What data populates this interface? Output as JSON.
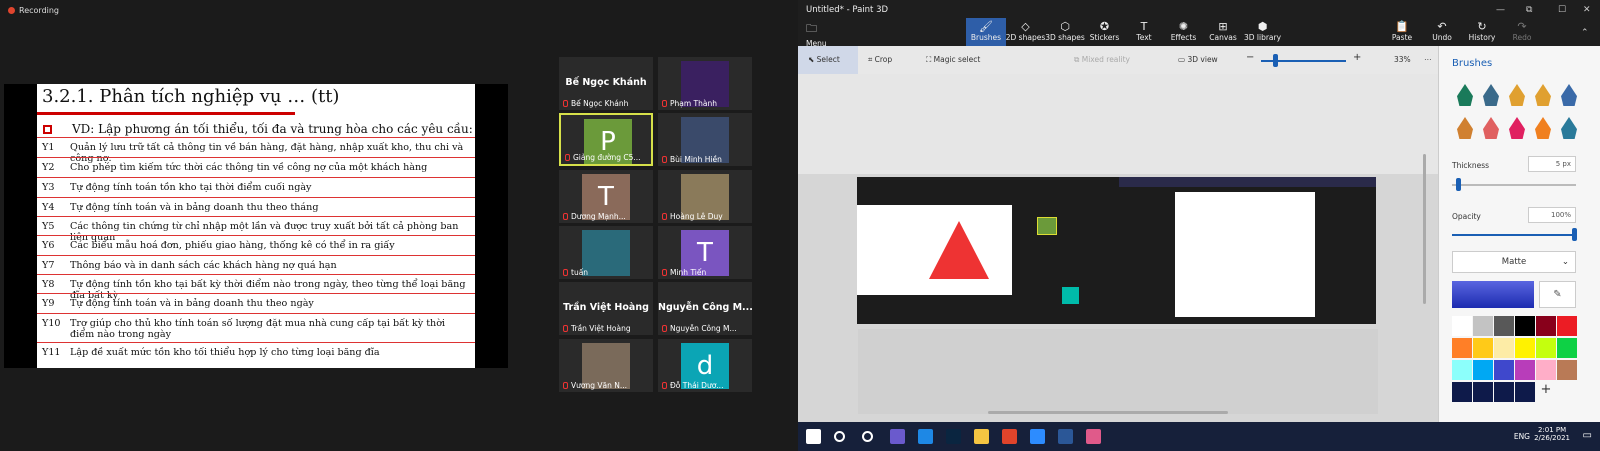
{
  "meeting": {
    "recording_label": "Recording",
    "slide": {
      "title": "3.2.1. Phân tích nghiệp vụ … (tt)",
      "vd": "VD: Lập phương án tối thiểu, tối đa và trung hòa cho các yêu cầu:",
      "rows": [
        {
          "id": "Y1",
          "text": "Quản lý lưu trữ tất cả thông tin về bán hàng, đặt hàng, nhập xuất kho, thu chi và công nợ."
        },
        {
          "id": "Y2",
          "text": "Cho phép tìm kiếm tức thời các thông tin về công nợ của một khách hàng"
        },
        {
          "id": "Y3",
          "text": "Tự động tính toán tồn kho tại thời điểm cuối ngày"
        },
        {
          "id": "Y4",
          "text": "Tự động tính toán và in bảng doanh thu theo tháng"
        },
        {
          "id": "Y5",
          "text": "Các thông tin chứng từ chỉ nhập một lần và được truy xuất bởi tất cả phòng ban liên quan"
        },
        {
          "id": "Y6",
          "text": "Các biểu mẫu hoá đơn, phiếu giao hàng, thống kê có thể in ra giấy"
        },
        {
          "id": "Y7",
          "text": "Thông báo và in danh sách các khách hàng nợ quá hạn"
        },
        {
          "id": "Y8",
          "text": "Tự động tính tồn kho tại bất kỳ thời điểm nào trong ngày, theo từng thể loại băng đĩa bất kỳ"
        },
        {
          "id": "Y9",
          "text": "Tự động tính toán và in bảng doanh thu theo ngày"
        },
        {
          "id": "Y10",
          "text": "Trợ giúp cho thủ kho tính toán số lượng đặt mua nhà cung cấp tại bất kỳ thời điểm nào trong ngày"
        },
        {
          "id": "Y11",
          "text": "Lập đề xuất mức tồn kho tối thiểu hợp lý cho từng loại băng đĩa"
        }
      ]
    },
    "participants": [
      {
        "name": "Bế Ngọc Khánh",
        "avatar": "",
        "name_only": true
      },
      {
        "name": "Phạm Thành",
        "avatar": "",
        "name_only": false
      },
      {
        "name": "Giảng đường C5...",
        "avatar": "P",
        "name_only": false
      },
      {
        "name": "Bùi Minh Hiền",
        "avatar": "",
        "name_only": false
      },
      {
        "name": "Dương Mạnh...",
        "avatar": "T",
        "name_only": false
      },
      {
        "name": "Hoàng Lê Duy",
        "avatar": "",
        "name_only": false
      },
      {
        "name": "tuấn",
        "avatar": "",
        "name_only": false
      },
      {
        "name": "Minh Tiến",
        "avatar": "T",
        "name_only": false
      },
      {
        "name": "Trần Việt Hoàng",
        "avatar": "",
        "name_only": true
      },
      {
        "name": "Nguyễn Công M...",
        "avatar": "",
        "name_only": true
      },
      {
        "name": "Vương Văn N...",
        "avatar": "",
        "name_only": false
      },
      {
        "name": "Đỗ Thái Dươ...",
        "avatar": "d",
        "name_only": false
      }
    ]
  },
  "paint": {
    "window_title": "Untitled* - Paint 3D",
    "menu_label": "Menu",
    "tools": [
      "Brushes",
      "2D shapes",
      "3D shapes",
      "Stickers",
      "Text",
      "Effects",
      "Canvas",
      "3D library"
    ],
    "right_tools": [
      "Paste",
      "Undo",
      "History",
      "Redo"
    ],
    "subbar": {
      "select": "Select",
      "crop": "Crop",
      "magic": "Magic select",
      "mixed": "Mixed reality",
      "view3d": "3D view",
      "zoom": "33%"
    },
    "sidebar": {
      "title": "Brushes",
      "thickness_label": "Thickness",
      "thickness_value": "5 px",
      "opacity_label": "Opacity",
      "opacity_value": "100%",
      "finish": "Matte",
      "accent": "#1a5fb4"
    }
  },
  "taskbar": {
    "lang": "ENG",
    "time": "2:01 PM",
    "date": "2/26/2021"
  }
}
